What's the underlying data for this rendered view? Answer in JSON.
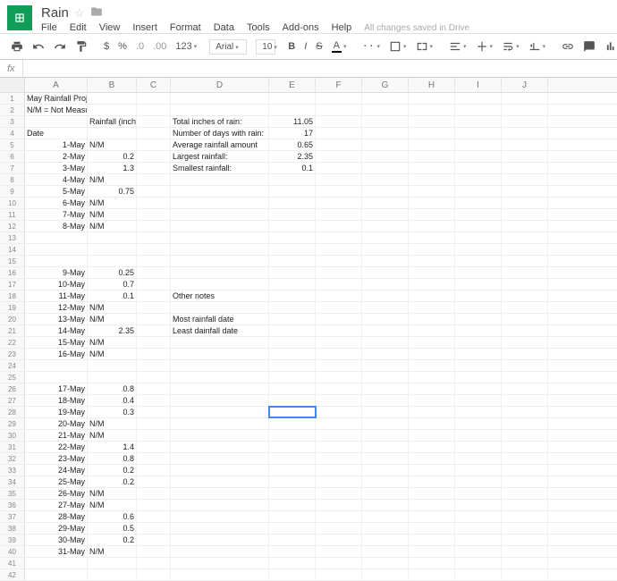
{
  "doc": {
    "title": "Rain",
    "save_status": "All changes saved in Drive"
  },
  "menus": {
    "file": "File",
    "edit": "Edit",
    "view": "View",
    "insert": "Insert",
    "format": "Format",
    "data": "Data",
    "tools": "Tools",
    "addons": "Add-ons",
    "help": "Help"
  },
  "toolbar": {
    "dollar": "$",
    "percent": "%",
    "dec1": ".0",
    "dec2": ".00",
    "num": "123",
    "font": "Arial",
    "size": "10",
    "bold": "B",
    "italic": "I",
    "strike": "S"
  },
  "fx": {
    "label": "fx",
    "value": ""
  },
  "columns": [
    "A",
    "B",
    "C",
    "D",
    "E",
    "F",
    "G",
    "H",
    "I",
    "J"
  ],
  "selected_cell": {
    "row": 28,
    "col": "E"
  },
  "cells": {
    "A1": "May Rainfall Project",
    "A2": "N/M = Not Measurable",
    "B3": "Rainfall (inches)",
    "D3": "Total inches of rain:",
    "E3": "11.05",
    "A4": "Date",
    "D4": "Number of days with rain:",
    "E4": "17",
    "A5": "1-May",
    "B5": "N/M",
    "D5": "Average rainfall amount",
    "E5": "0.65",
    "A6": "2-May",
    "B6": "0.2",
    "D6": "Largest rainfall:",
    "E6": "2.35",
    "A7": "3-May",
    "B7": "1.3",
    "D7": "Smallest rainfall:",
    "E7": "0.1",
    "A8": "4-May",
    "B8": "N/M",
    "A9": "5-May",
    "B9": "0.75",
    "A10": "6-May",
    "B10": "N/M",
    "A11": "7-May",
    "B11": "N/M",
    "A12": "8-May",
    "B12": "N/M",
    "A16": "9-May",
    "B16": "0.25",
    "A17": "10-May",
    "B17": "0.7",
    "A18": "11-May",
    "B18": "0.1",
    "D18": "Other notes",
    "A19": "12-May",
    "B19": "N/M",
    "A20": "13-May",
    "B20": "N/M",
    "D20": "Most rainfall date",
    "A21": "14-May",
    "B21": "2.35",
    "D21": "Least dainfall date",
    "A22": "15-May",
    "B22": "N/M",
    "A23": "16-May",
    "B23": "N/M",
    "A26": "17-May",
    "B26": "0.8",
    "A27": "18-May",
    "B27": "0.4",
    "A28": "19-May",
    "B28": "0.3",
    "A29": "20-May",
    "B29": "N/M",
    "A30": "21-May",
    "B30": "N/M",
    "A31": "22-May",
    "B31": "1.4",
    "A32": "23-May",
    "B32": "0.8",
    "A33": "24-May",
    "B33": "0.2",
    "A34": "25-May",
    "B34": "0.2",
    "A35": "26-May",
    "B35": "N/M",
    "A36": "27-May",
    "B36": "N/M",
    "A37": "28-May",
    "B37": "0.6",
    "A38": "29-May",
    "B38": "0.5",
    "A39": "30-May",
    "B39": "0.2",
    "A40": "31-May",
    "B40": "N/M"
  },
  "row_count": 42
}
